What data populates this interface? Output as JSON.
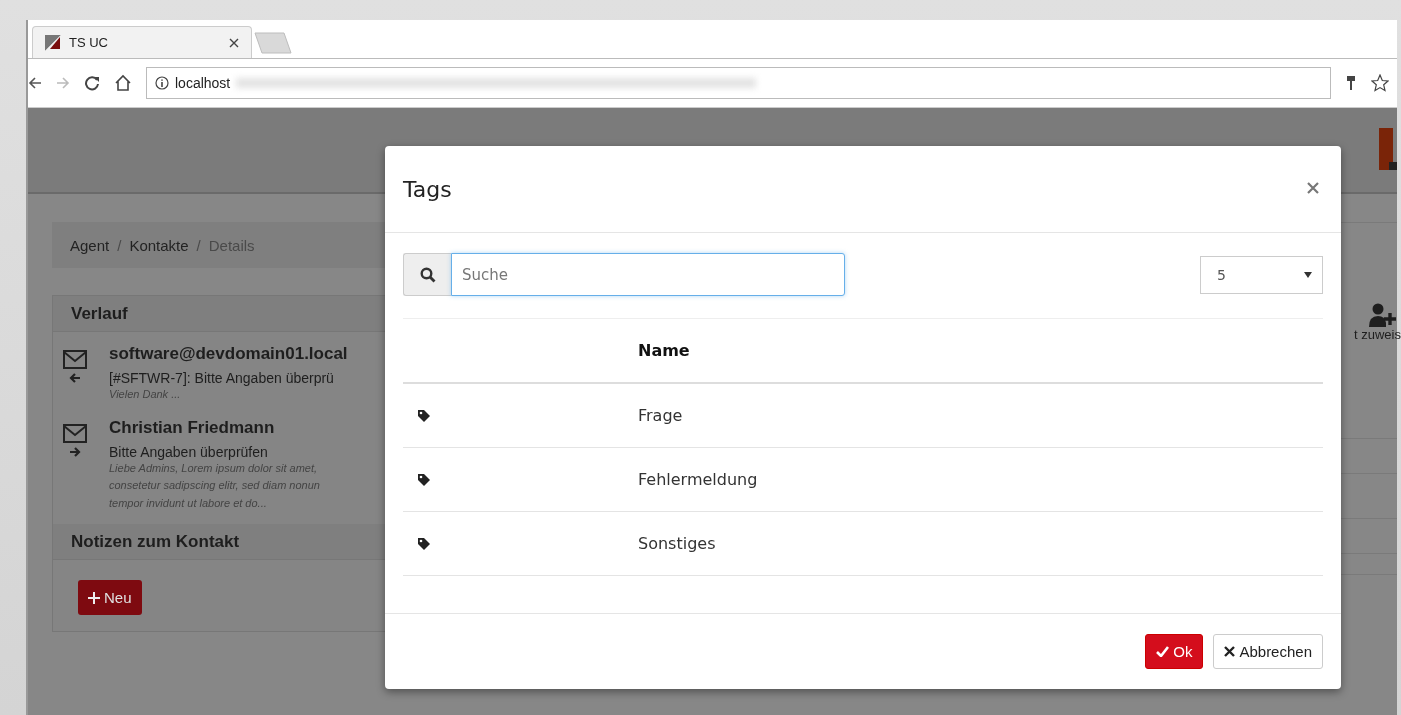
{
  "browser": {
    "tabs": [
      {
        "title": "TS UC",
        "selected": true
      }
    ],
    "url": "localhost"
  },
  "page": {
    "breadcrumb": [
      {
        "label": "Agent",
        "current": false,
        "separator": "/"
      },
      {
        "label": "Kontakte",
        "current": false,
        "separator": "/"
      },
      {
        "label": "Details",
        "current": true
      }
    ],
    "history": {
      "title": "Verlauf",
      "items": [
        {
          "kind": "incoming",
          "sender": "software@devdomain01.local",
          "subject": "[#SFTWR-7]: Bitte Angaben überprü",
          "preview": [
            "Vielen Dank ..."
          ]
        },
        {
          "kind": "outgoing",
          "sender": "Christian Friedmann",
          "subject": "Bitte Angaben überprüfen",
          "preview": [
            "Liebe Admins,  Lorem ipsum dolor sit amet,",
            "consetetur sadipscing elitr, sed diam nonun",
            "tempor invidunt ut labore et do..."
          ]
        }
      ]
    },
    "notes": {
      "title": "Notizen zum Kontakt",
      "new_button": "Neu"
    },
    "side_action": {
      "label": "t zuweis"
    }
  },
  "dialog": {
    "title": "Tags",
    "search": {
      "placeholder": "Suche"
    },
    "page_size": "5",
    "columns": [
      "Name"
    ],
    "rows": [
      {
        "name": "Frage"
      },
      {
        "name": "Fehlermeldung"
      },
      {
        "name": "Sonstiges"
      }
    ],
    "ok_button": "Ok",
    "cancel_button": "Abbrechen"
  }
}
